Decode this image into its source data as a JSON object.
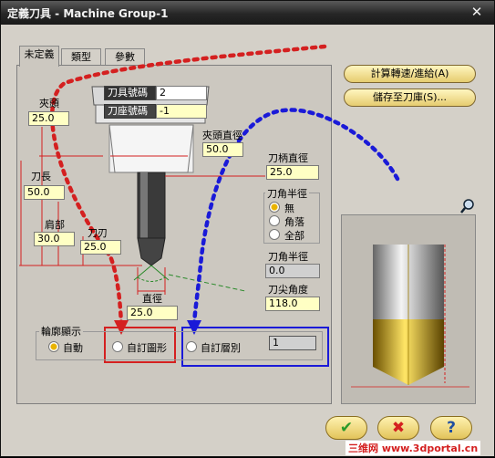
{
  "window": {
    "title": "定義刀具 - Machine Group-1",
    "close_glyph": "✕"
  },
  "tabs": [
    {
      "label": "未定義"
    },
    {
      "label": "類型"
    },
    {
      "label": "參數"
    }
  ],
  "fields": {
    "tool_number": {
      "label": "刀具號碼",
      "value": "2"
    },
    "holder_number": {
      "label": "刀座號碼",
      "value": "-1"
    },
    "chuck": {
      "label": "夾頭",
      "value": "25.0"
    },
    "chuck_diameter": {
      "label": "夾頭直徑",
      "value": "50.0"
    },
    "shank_diameter": {
      "label": "刀柄直徑",
      "value": "25.0"
    },
    "tool_length": {
      "label": "刀長",
      "value": "50.0"
    },
    "shoulder": {
      "label": "肩部",
      "value": "30.0"
    },
    "flute": {
      "label": "刀刃",
      "value": "25.0"
    },
    "diameter": {
      "label": "直徑",
      "value": "25.0"
    },
    "corner_radius_value": {
      "label": "刀角半徑",
      "value": "0.0"
    },
    "tip_angle": {
      "label": "刀尖角度",
      "value": "118.0"
    }
  },
  "corner_radius_group": {
    "title": "刀角半徑",
    "options": [
      {
        "label": "無",
        "selected": true
      },
      {
        "label": "角落",
        "selected": false
      },
      {
        "label": "全部",
        "selected": false
      }
    ]
  },
  "profile_group": {
    "title": "輪廓顯示",
    "options": [
      {
        "label": "自動",
        "selected": true
      },
      {
        "label": "自訂圖形",
        "selected": false
      },
      {
        "label": "自訂層別",
        "selected": false
      }
    ],
    "layer_value": "1"
  },
  "buttons": {
    "calc": "計算轉速/進給(A)",
    "save": "儲存至刀庫(S)...",
    "ok": "✔",
    "cancel": "✖",
    "help": "?"
  },
  "preview": {
    "zoom_icon": "magnifier-icon"
  },
  "watermark": "三维网 www.3dportal.cn",
  "colors": {
    "highlight_red": "#d42020",
    "highlight_blue": "#1a1ad8",
    "field_yellow": "#ffffc4",
    "button_gold": "#e2c35a"
  }
}
